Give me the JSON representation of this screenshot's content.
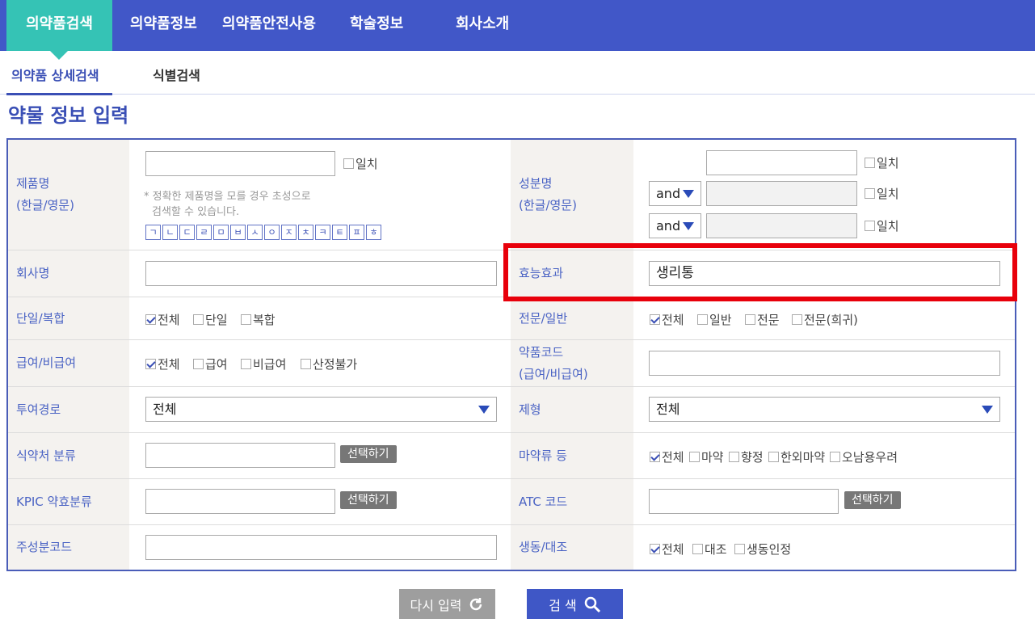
{
  "nav": {
    "tabs": [
      {
        "label": "의약품검색"
      },
      {
        "label": "의약품정보"
      },
      {
        "label": "의약품안전사용"
      },
      {
        "label": "학술정보"
      },
      {
        "label": "회사소개"
      }
    ]
  },
  "subnav": {
    "tabs": [
      {
        "label": "의약품 상세검색"
      },
      {
        "label": "식별검색"
      }
    ]
  },
  "section_title": "약물 정보 입력",
  "fields": {
    "product_name": {
      "label1": "제품명",
      "label2": "(한글/영문)",
      "value": "",
      "exact": "일치",
      "hint1": "* 정확한 제품명을 모를 경우 초성으로",
      "hint2": "검색할 수 있습니다.",
      "jamo": [
        "ㄱ",
        "ㄴ",
        "ㄷ",
        "ㄹ",
        "ㅁ",
        "ㅂ",
        "ㅅ",
        "ㅇ",
        "ㅈ",
        "ㅊ",
        "ㅋ",
        "ㅌ",
        "ㅍ",
        "ㅎ"
      ]
    },
    "ingredient": {
      "label1": "성분명",
      "label2": "(한글/영문)",
      "exact": "일치",
      "op1": "and",
      "op2": "and"
    },
    "company": {
      "label": "회사명",
      "value": ""
    },
    "efficacy": {
      "label": "효능효과",
      "value": "생리통"
    },
    "single_combo": {
      "label": "단일/복합",
      "options": [
        "전체",
        "단일",
        "복합"
      ]
    },
    "prof_general": {
      "label": "전문/일반",
      "options": [
        "전체",
        "일반",
        "전문",
        "전문(희귀)"
      ]
    },
    "coverage": {
      "label": "급여/비급여",
      "options": [
        "전체",
        "급여",
        "비급여",
        "산정불가"
      ]
    },
    "drug_code": {
      "label1": "약품코드",
      "label2": "(급여/비급여)",
      "value": ""
    },
    "route": {
      "label": "투여경로",
      "selected": "전체"
    },
    "form": {
      "label": "제형",
      "selected": "전체"
    },
    "mfds_class": {
      "label": "식약처 분류",
      "button": "선택하기"
    },
    "narcotics": {
      "label": "마약류 등",
      "options": [
        "전체",
        "마약",
        "향정",
        "한외마약",
        "오남용우려"
      ]
    },
    "kpic": {
      "label": "KPIC 약효분류",
      "button": "선택하기"
    },
    "atc": {
      "label": "ATC 코드",
      "button": "선택하기"
    },
    "ingredient_code": {
      "label": "주성분코드",
      "value": ""
    },
    "bioequiv": {
      "label": "생동/대조",
      "options": [
        "전체",
        "대조",
        "생동인정"
      ]
    }
  },
  "buttons": {
    "reset": "다시 입력",
    "search": "검 색"
  }
}
